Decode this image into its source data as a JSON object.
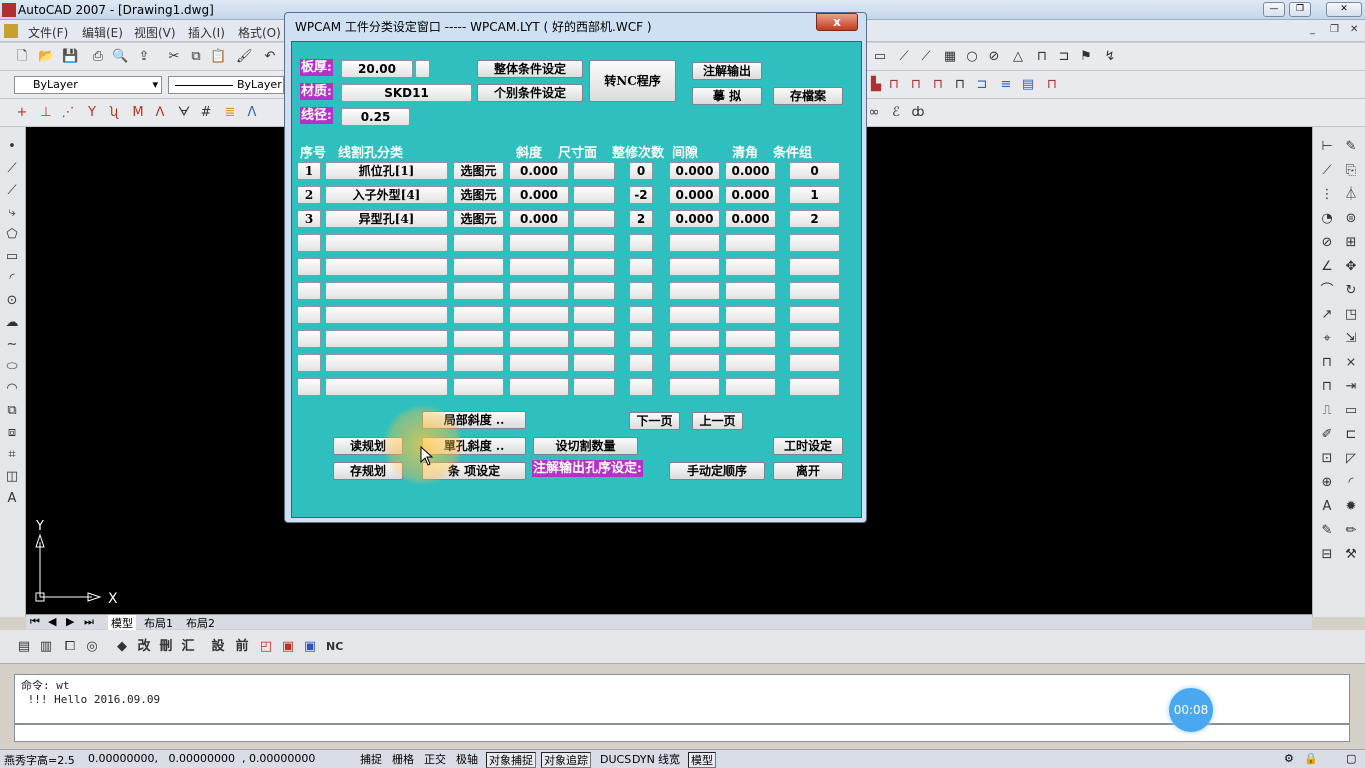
{
  "app": {
    "title": "AutoCAD 2007 - [Drawing1.dwg]",
    "menus": [
      "文件(F)",
      "编辑(E)",
      "视图(V)",
      "插入(I)",
      "格式(O)"
    ],
    "layer_dropdown": "ByLayer",
    "linetype_dropdown": "ByLayer"
  },
  "dialog": {
    "title": "WPCAM 工件分类设定窗口 ----- WPCAM.LYT ( 好的西部机.WCF )",
    "close_label": "x",
    "thickness_label": "板厚:",
    "thickness_value": "20.00",
    "material_label": "材质:",
    "material_value": "SKD11",
    "wire_label": "线径:",
    "wire_value": "0.25",
    "btn_overall": "整体条件设定",
    "btn_individual": "个别条件设定",
    "btn_to_nc": "转NC程序",
    "btn_annot_out": "注解输出",
    "btn_simulate": "摹 拟",
    "btn_save_file": "存檔案",
    "headers": {
      "seq": "序号",
      "class": "线割孔分类",
      "taper": "斜度",
      "size_face": "尺寸面",
      "trim": "整修次数",
      "gap": "间隙",
      "clear": "清角",
      "cond": "条件组"
    },
    "rows": [
      {
        "seq": "1",
        "class": "抓位孔[1]",
        "pick": "选图元",
        "taper": "0.000",
        "trim": "0",
        "gap": "0.000",
        "clear": "0.000",
        "cond": "0"
      },
      {
        "seq": "2",
        "class": "入子外型[4]",
        "pick": "选图元",
        "taper": "0.000",
        "trim": "-2",
        "gap": "0.000",
        "clear": "0.000",
        "cond": "1"
      },
      {
        "seq": "3",
        "class": "异型孔[4]",
        "pick": "选图元",
        "taper": "0.000",
        "trim": "2",
        "gap": "0.000",
        "clear": "0.000",
        "cond": "2"
      }
    ],
    "btn_local_taper": "局部斜度 ..",
    "btn_next_page": "下一页",
    "btn_prev_page": "上一页",
    "btn_read_plan": "读规划",
    "btn_single_taper": "單孔斜度 ..",
    "btn_cut_count": "设切割数量",
    "btn_work_hours": "工时设定",
    "btn_save_plan": "存规划",
    "btn_item_setting": "条 项设定",
    "annot_order_label": "注解输出孔序设定:",
    "btn_manual_order": "手动定顺序",
    "btn_leave": "离开"
  },
  "layout_tabs": [
    "模型",
    "布局1",
    "布局2"
  ],
  "command": {
    "line1": "命令: wt",
    "line2": " !!! Hello 2016.09.09"
  },
  "timer": "00:08",
  "status": {
    "text_height": "燕秀字高=2.5",
    "coords": "0.00000000,   0.00000000  , 0.00000000",
    "toggles": [
      "捕捉",
      "栅格",
      "正交",
      "极轴",
      "对象捕捉",
      "对象追踪",
      "DUCS",
      "DYN",
      "线宽",
      "模型"
    ]
  },
  "ucs": {
    "x_label": "X",
    "y_label": "Y"
  }
}
